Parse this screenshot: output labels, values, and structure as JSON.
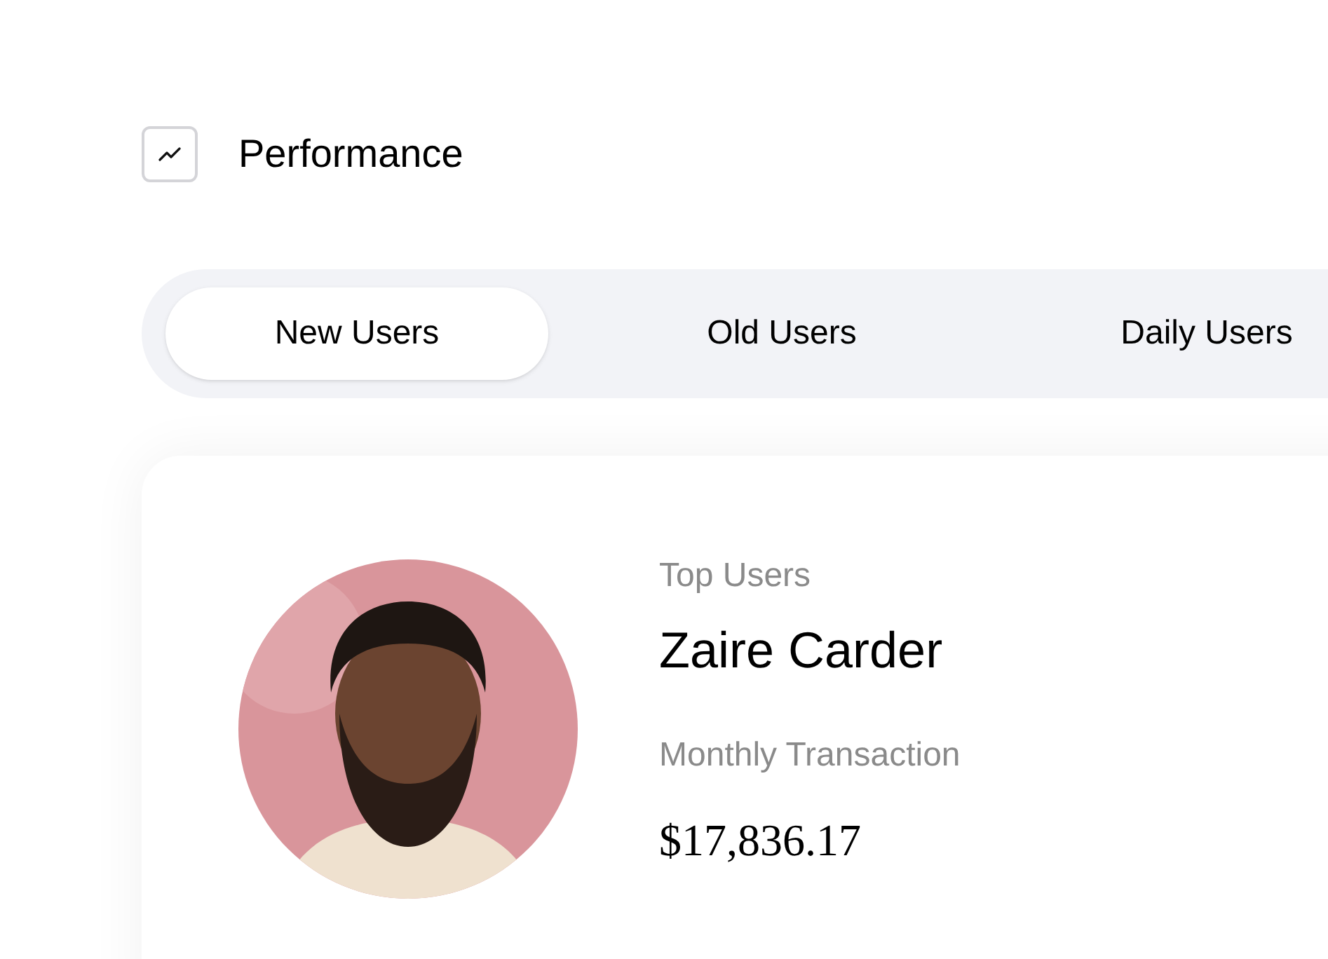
{
  "header": {
    "title": "Performance"
  },
  "tabs": [
    {
      "label": "New Users",
      "selected": true
    },
    {
      "label": "Old Users",
      "selected": false
    },
    {
      "label": "Daily Users",
      "selected": false
    }
  ],
  "card": {
    "label": "Top Users",
    "name": "Zaire Carder",
    "amount_label": "Monthly Transaction",
    "amount": "$17,836.17"
  }
}
